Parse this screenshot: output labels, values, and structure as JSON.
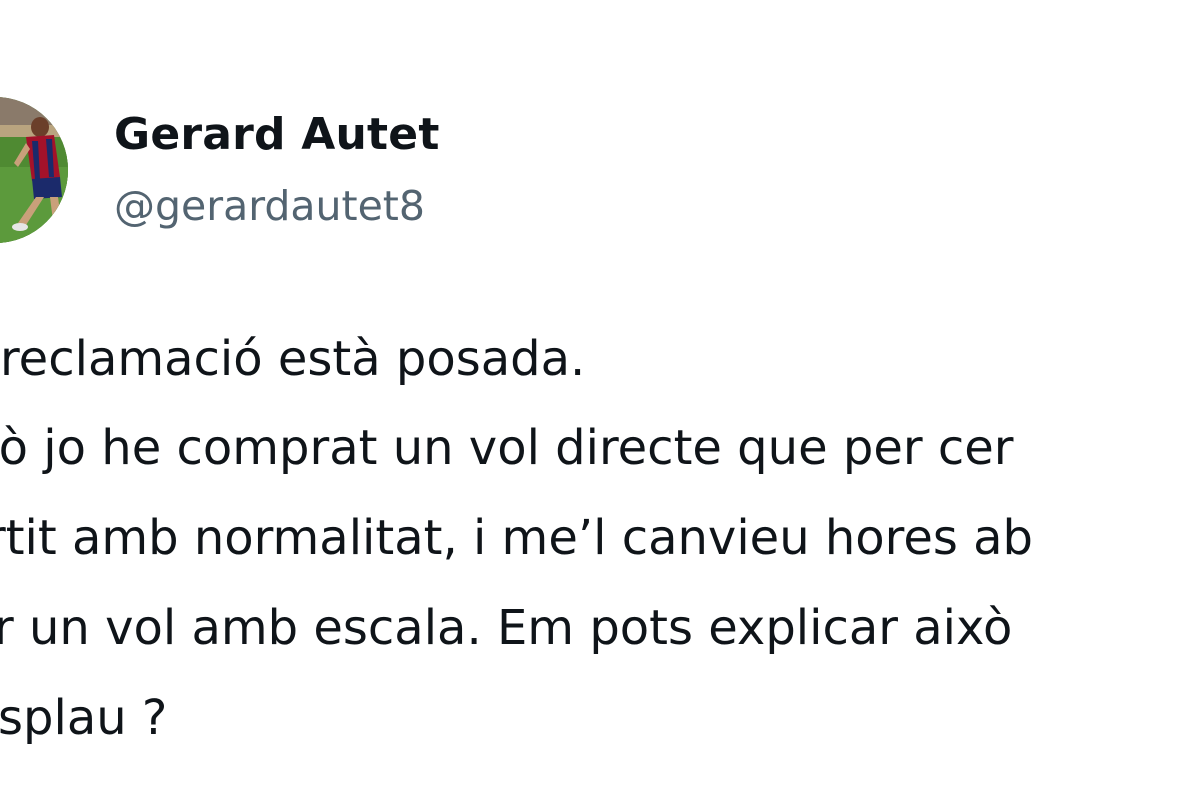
{
  "author": {
    "display_name": "Gerard Autet",
    "handle": "@gerardautet8",
    "avatar_icon": "profile-photo-footballer"
  },
  "tweet": {
    "lines": [
      "reclamació està posada.",
      "rò jo he comprat un vol directe que per cer",
      "rtit amb normalitat, i me’l canvieu hores ab",
      "r un vol amb escala. Em pots explicar això",
      "splau ?"
    ]
  },
  "colors": {
    "text": "#0f1419",
    "secondary_text": "#536471",
    "background": "#ffffff"
  }
}
